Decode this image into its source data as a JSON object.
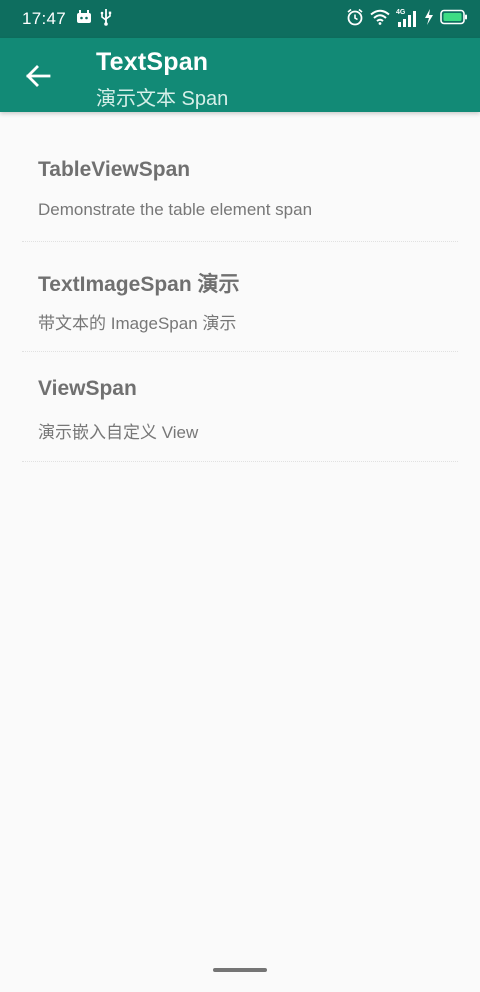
{
  "status_bar": {
    "time": "17:47",
    "network_label": "4G",
    "icons": [
      "notification-icon",
      "usb-icon",
      "alarm-icon",
      "wifi-icon",
      "signal-icon",
      "charging-icon",
      "battery-icon"
    ]
  },
  "app_bar": {
    "title": "TextSpan",
    "subtitle": "演示文本 Span",
    "back_icon": "arrow-back-icon"
  },
  "list": {
    "items": [
      {
        "title": "TableViewSpan",
        "description": "Demonstrate the table element span"
      },
      {
        "title": "TextImageSpan 演示",
        "description": "带文本的 ImageSpan 演示"
      },
      {
        "title": "ViewSpan",
        "description": "演示嵌入自定义 View"
      }
    ]
  },
  "colors": {
    "status_bar": "#0e6e5f",
    "app_bar": "#128a76",
    "background": "#fafafa",
    "battery": "#3ddc84"
  }
}
